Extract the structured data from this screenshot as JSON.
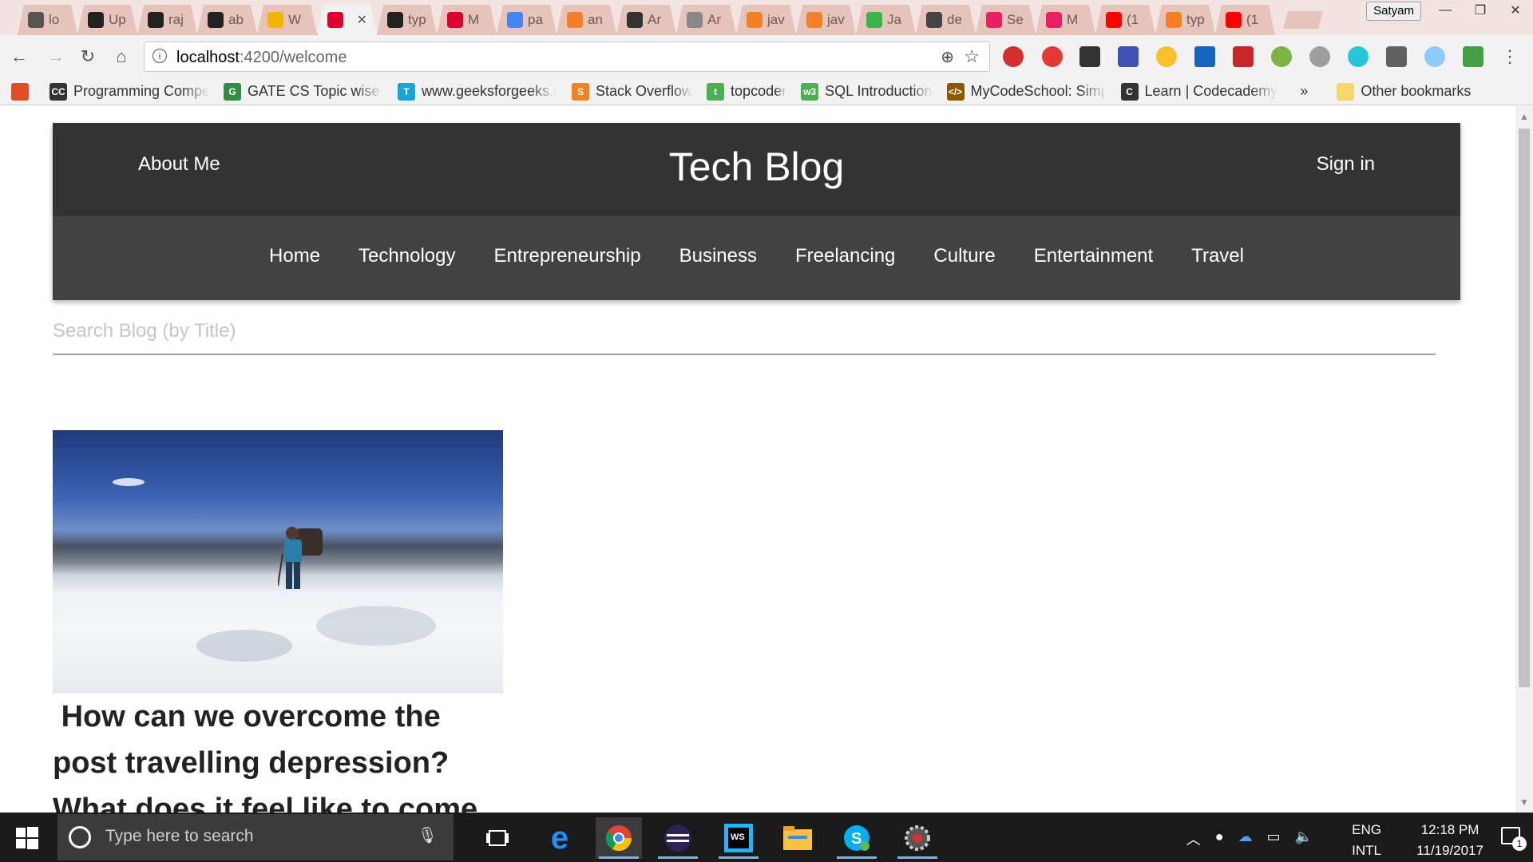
{
  "browser": {
    "tabs": [
      {
        "label": "lo",
        "color": "#555555"
      },
      {
        "label": "Up",
        "color": "#222222"
      },
      {
        "label": "raj",
        "color": "#222222"
      },
      {
        "label": "ab",
        "color": "#222222"
      },
      {
        "label": "W",
        "color": "#f4b400"
      },
      {
        "label": "",
        "color": "#dd0031",
        "active": true
      },
      {
        "label": "typ",
        "color": "#222222"
      },
      {
        "label": "M",
        "color": "#dd0031"
      },
      {
        "label": "pa",
        "color": "#4285f4"
      },
      {
        "label": "an",
        "color": "#f48024"
      },
      {
        "label": "Ar",
        "color": "#333333"
      },
      {
        "label": "Ar",
        "color": "#888888"
      },
      {
        "label": "jav",
        "color": "#f48024"
      },
      {
        "label": "jav",
        "color": "#f48024"
      },
      {
        "label": "Ja",
        "color": "#39b54a"
      },
      {
        "label": "de",
        "color": "#444444"
      },
      {
        "label": "Se",
        "color": "#e91e63"
      },
      {
        "label": "M",
        "color": "#e91e63"
      },
      {
        "label": "(1",
        "color": "#ff0000"
      },
      {
        "label": "typ",
        "color": "#f48024"
      },
      {
        "label": "(1",
        "color": "#ff0000"
      }
    ],
    "profile": "Satyam",
    "url_host": "localhost",
    "url_path": ":4200/welcome",
    "bookmarks": [
      {
        "label": "",
        "color": "#e34c26"
      },
      {
        "label": "Programming Compe",
        "color": "#333333",
        "icon": "CC"
      },
      {
        "label": "GATE CS Topic wise p",
        "color": "#2f8d46",
        "icon": "G"
      },
      {
        "label": "www.geeksforgeeks.c",
        "color": "#1aa3d9",
        "icon": "T"
      },
      {
        "label": "Stack Overflow",
        "color": "#f48024",
        "icon": "S"
      },
      {
        "label": "topcoder",
        "color": "#4caf50",
        "icon": "t"
      },
      {
        "label": "SQL Introduction",
        "color": "#4caf50",
        "icon": "w3"
      },
      {
        "label": "MyCodeSchool: Simp",
        "color": "#8b5a00",
        "icon": "</>"
      },
      {
        "label": "Learn | Codecademy",
        "color": "#333333",
        "icon": "C"
      }
    ],
    "bookmarks_more": "»",
    "other_bookmarks": "Other bookmarks"
  },
  "site": {
    "about": "About Me",
    "brand": "Tech Blog",
    "signin": "Sign in",
    "nav": [
      "Home",
      "Technology",
      "Entrepreneurship",
      "Business",
      "Freelancing",
      "Culture",
      "Entertainment",
      "Travel"
    ],
    "search_placeholder": "Search Blog (by Title)",
    "post": {
      "title": " How can we overcome the post travelling depression? What does it feel like to come home?"
    }
  },
  "taskbar": {
    "search_placeholder": "Type here to search",
    "lang_top": "ENG",
    "lang_bottom": "INTL",
    "time": "12:18 PM",
    "date": "11/19/2017",
    "notification_count": "1"
  }
}
